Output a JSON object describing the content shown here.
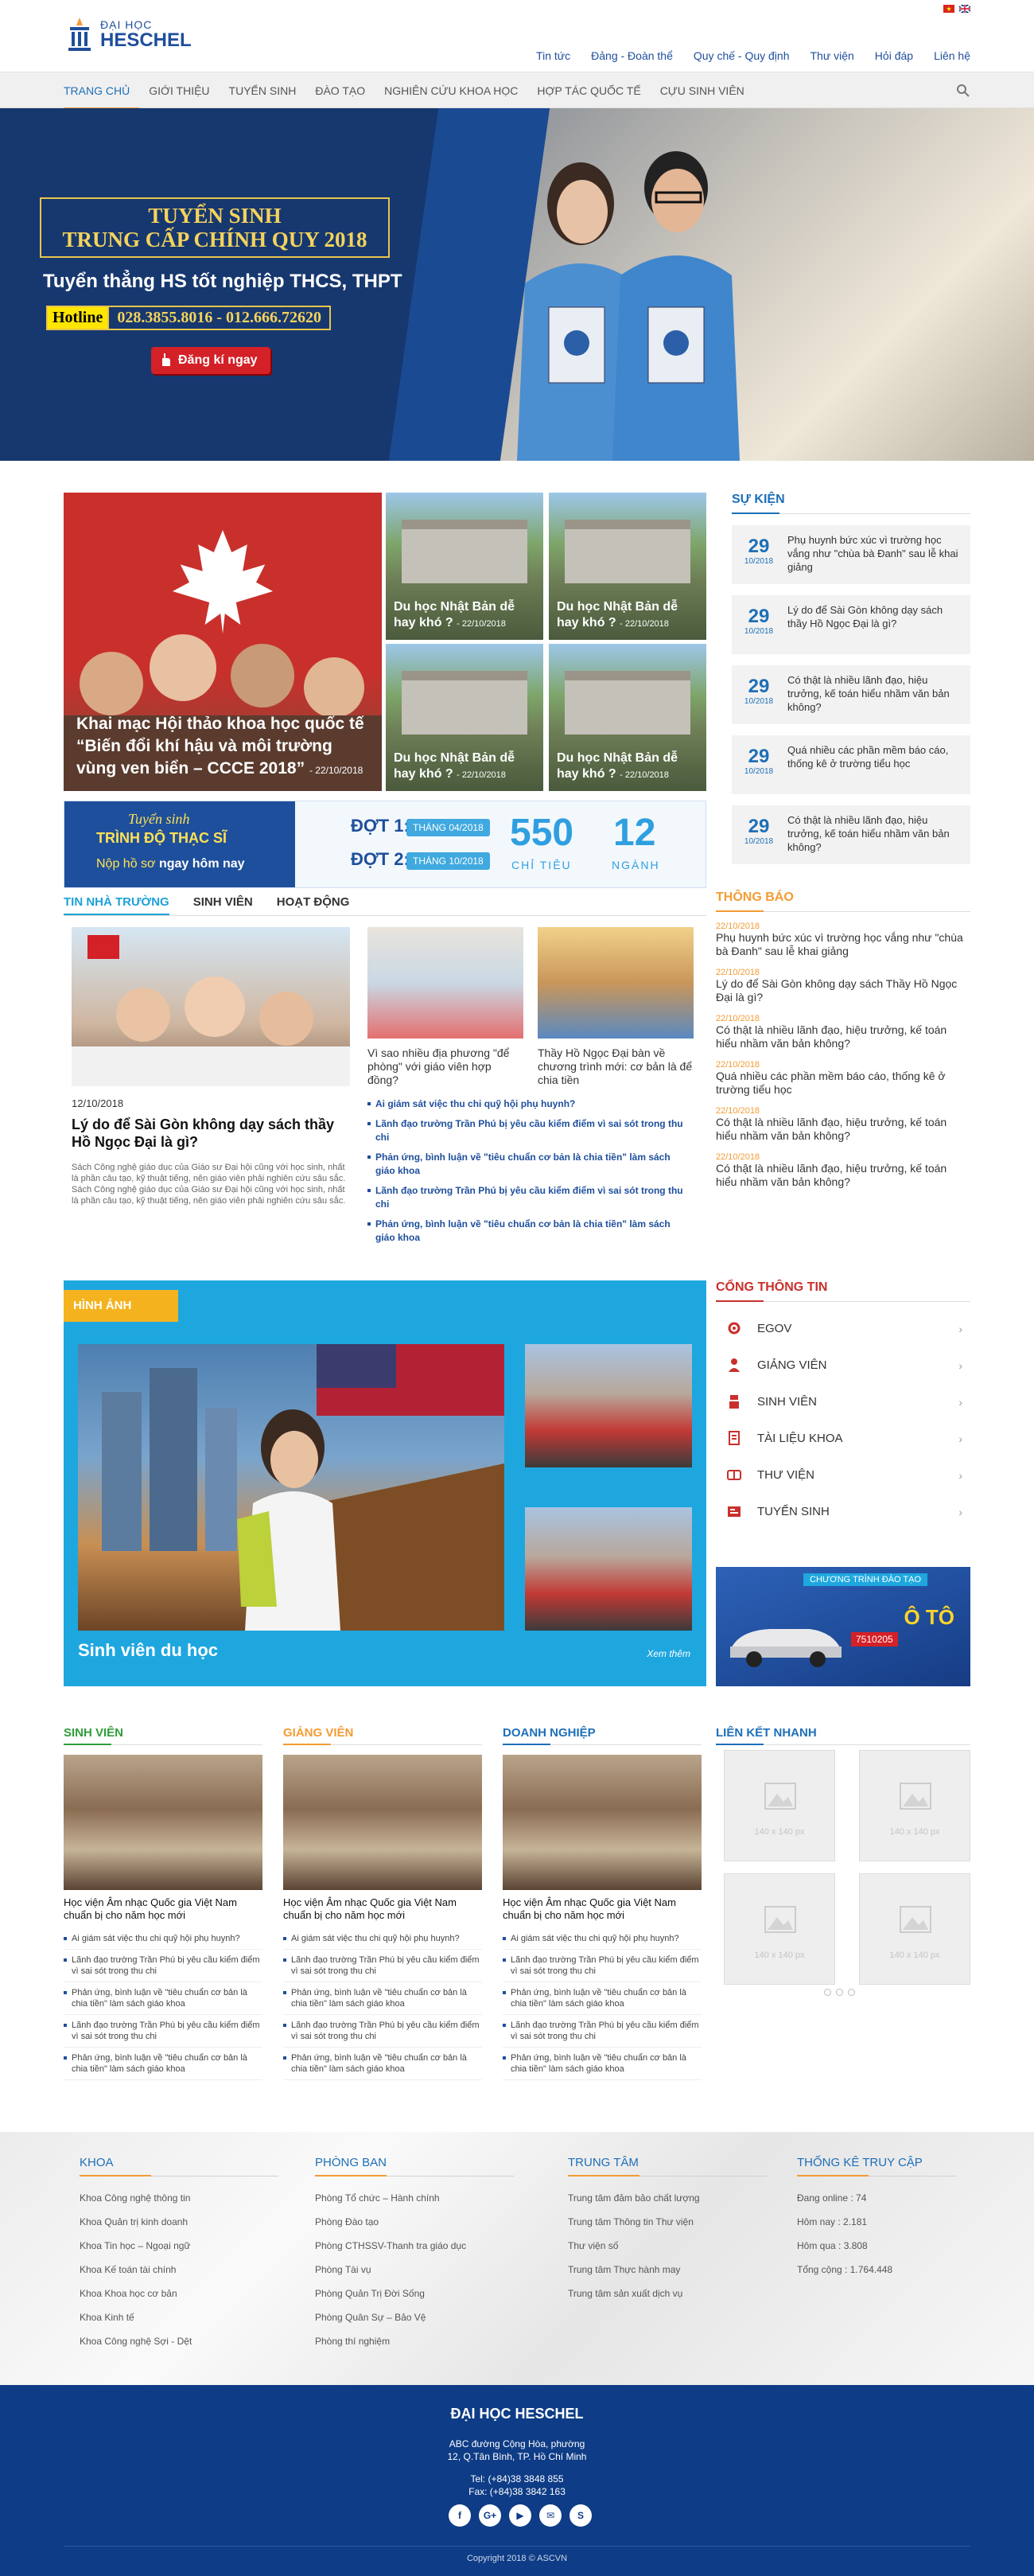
{
  "header": {
    "logo_line1": "ĐẠI HỌC",
    "logo_line2": "HESCHEL",
    "top_links": [
      "Tin tức",
      "Đảng - Đoàn thể",
      "Quy chế - Quy định",
      "Thư viện",
      "Hỏi đáp",
      "Liên hệ"
    ],
    "main_nav": [
      "TRANG CHỦ",
      "GIỚI THIỆU",
      "TUYỂN SINH",
      "ĐÀO TẠO",
      "NGHIÊN CỨU KHOA HỌC",
      "HỢP TÁC QUỐC TẾ",
      "CỰU SINH VIÊN"
    ]
  },
  "hero": {
    "title1": "TUYỂN SINH",
    "title2": "TRUNG CẤP CHÍNH QUY 2018",
    "subtitle": "Tuyển thẳng HS tốt nghiệp THCS, THPT",
    "hotline_label": "Hotline",
    "hotline_number": "028.3855.8016 - 012.666.72620",
    "button": "Đăng kí ngay"
  },
  "featured": {
    "big": {
      "title": "Khai mạc Hội thảo khoa học quốc tế “Biến đổi khí hậu và môi trường vùng ven biển – CCCE 2018”",
      "date": "- 22/10/2018"
    },
    "small": [
      {
        "title": "Du học Nhật Bản dễ hay khó ?",
        "date": "- 22/10/2018"
      },
      {
        "title": "Du học Nhật Bản dễ hay khó ?",
        "date": "- 22/10/2018"
      },
      {
        "title": "Du học Nhật Bản dễ hay khó ?",
        "date": "- 22/10/2018"
      },
      {
        "title": "Du học Nhật Bản dễ hay khó ?",
        "date": "- 22/10/2018"
      }
    ]
  },
  "banner": {
    "line1": "Tuyển sinh",
    "line2": "TRÌNH ĐỘ THẠC SĨ",
    "line3a": "Nộp hồ sơ",
    "line3b": " ngay hôm nay",
    "dot1": "ĐỢT 1:",
    "dot1_date": "THÁNG 04/2018",
    "dot2": "ĐỢT 2:",
    "dot2_date": "THÁNG 10/2018",
    "quota": "550",
    "quota_label": "CHỈ TIÊU",
    "majors": "12",
    "majors_label": "NGÀNH"
  },
  "events": {
    "heading": "SỰ KIỆN",
    "items": [
      {
        "day": "29",
        "month": "10/2018",
        "title": "Phụ huynh bức xúc vì trường học vắng như \"chùa bà Đanh\" sau lễ khai giảng"
      },
      {
        "day": "29",
        "month": "10/2018",
        "title": "Lý do để Sài Gòn không dạy sách thầy Hồ Ngọc Đại là gì?"
      },
      {
        "day": "29",
        "month": "10/2018",
        "title": "Có thật là nhiều lãnh đạo, hiệu trưởng, kế toán hiểu nhầm văn bản không?"
      },
      {
        "day": "29",
        "month": "10/2018",
        "title": "Quá nhiều các phần mềm báo cáo, thống kê ở trường tiểu học"
      },
      {
        "day": "29",
        "month": "10/2018",
        "title": "Có thật là nhiều lãnh đạo, hiệu trưởng, kế toán hiểu nhầm văn bản không?"
      }
    ]
  },
  "news": {
    "tabs": [
      "TIN NHÀ TRƯỜNG",
      "SINH VIÊN",
      "HOẠT ĐỘNG"
    ],
    "main": {
      "date": "12/10/2018",
      "title": "Lý do để Sài Gòn không dạy sách thầy Hồ Ngọc Đại là gì?",
      "desc": "Sách Công nghệ giáo dục của Giáo sư Đại hội cũng với học sinh, nhất là phần câu tạo, kỹ thuật tiếng, nên giáo viên phải nghiên cứu sâu sắc. Sách Công nghệ giáo dục của Giáo sư Đại hội cũng với học sinh, nhất là phần câu tạo, kỹ thuật tiếng, nên giáo viên phải nghiên cứu sâu sắc."
    },
    "side": [
      {
        "title": "Vì sao nhiều địa phương \"để phòng\" với giáo viên hợp đồng?"
      },
      {
        "title": "Thầy Hồ Ngọc Đại bàn về chương trình mới: cơ bản là để chia tiền"
      }
    ],
    "list": [
      "Ai giám sát việc thu chi quỹ hội phụ huynh?",
      "Lãnh đạo trường Trần Phú bị yêu cầu kiểm điểm vì sai sót trong thu chi",
      "Phản ứng, bình luận về \"tiêu chuẩn cơ bản là chia tiền\" làm sách giáo khoa",
      "Lãnh đạo trường Trần Phú bị yêu cầu kiểm điểm vì sai sót trong thu chi",
      "Phản ứng, bình luận về \"tiêu chuẩn cơ bản là chia tiền\" làm sách giáo khoa"
    ]
  },
  "notices": {
    "heading": "THÔNG BÁO",
    "items": [
      {
        "date": "22/10/2018",
        "title": "Phụ huynh bức xúc vì trường học vắng như \"chùa bà Đanh\" sau lễ khai giảng"
      },
      {
        "date": "22/10/2018",
        "title": "Lý do để Sài Gòn không dạy sách Thầy Hồ Ngọc Đại là gì?"
      },
      {
        "date": "22/10/2018",
        "title": "Có thật là nhiều lãnh đạo, hiệu trưởng, kế toán hiểu nhầm văn bản không?"
      },
      {
        "date": "22/10/2018",
        "title": "Quá nhiều các phần mềm báo cáo, thống kê ở trường tiểu học"
      },
      {
        "date": "22/10/2018",
        "title": "Có thật là nhiều lãnh đạo, hiệu trưởng, kế toán hiểu nhầm văn bản không?"
      },
      {
        "date": "22/10/2018",
        "title": "Có thật là nhiều lãnh đạo, hiệu trưởng, kế toán hiểu nhầm văn bản không?"
      }
    ]
  },
  "gallery": {
    "heading": "HÌNH ẢNH",
    "caption": "Sinh viên du học",
    "more": "Xem thêm"
  },
  "portal": {
    "heading": "CỔNG THÔNG TIN",
    "items": [
      {
        "label": "EGOV",
        "icon": "gear-icon"
      },
      {
        "label": "GIẢNG VIÊN",
        "icon": "teacher-icon"
      },
      {
        "label": "SINH VIÊN",
        "icon": "student-icon"
      },
      {
        "label": "TÀI LIỆU KHOA",
        "icon": "document-icon"
      },
      {
        "label": "THƯ VIỆN",
        "icon": "library-icon"
      },
      {
        "label": "TUYỂN SINH",
        "icon": "enrollment-icon"
      }
    ]
  },
  "ad": {
    "top": "CHƯƠNG TRÌNH ĐÀO TẠO",
    "big": "Ô TÔ",
    "code": "7510205"
  },
  "columns": [
    {
      "heading": "SINH VIÊN",
      "color": "#2e9e3a",
      "title": "Học viện Âm nhạc Quốc gia Việt Nam chuẩn bị cho năm học mới",
      "list": [
        "Ai giám sát việc thu chi quỹ hội phụ huynh?",
        "Lãnh đạo trường Trần Phú bị yêu cầu kiểm điểm vì sai sót trong thu chi",
        "Phản ứng, bình luận về \"tiêu chuẩn cơ bản là chia tiền\" làm sách giáo khoa",
        "Lãnh đạo trường Trần Phú bị yêu cầu kiểm điểm vì sai sót trong thu chi",
        "Phản ứng, bình luận về \"tiêu chuẩn cơ bản là chia tiền\" làm sách giáo khoa"
      ]
    },
    {
      "heading": "GIẢNG VIÊN",
      "color": "#f39c34",
      "title": "Học viện Âm nhạc Quốc gia Việt Nam chuẩn bị cho năm học mới",
      "list": [
        "Ai giám sát việc thu chi quỹ hội phụ huynh?",
        "Lãnh đạo trường Trần Phú bị yêu cầu kiểm điểm vì sai sót trong thu chi",
        "Phản ứng, bình luận về \"tiêu chuẩn cơ bản là chia tiền\" làm sách giáo khoa",
        "Lãnh đạo trường Trần Phú bị yêu cầu kiểm điểm vì sai sót trong thu chi",
        "Phản ứng, bình luận về \"tiêu chuẩn cơ bản là chia tiền\" làm sách giáo khoa"
      ]
    },
    {
      "heading": "DOANH NGHIỆP",
      "color": "#1e6fb8",
      "title": "Học viện Âm nhạc Quốc gia Việt Nam chuẩn bị cho năm học mới",
      "list": [
        "Ai giám sát việc thu chi quỹ hội phụ huynh?",
        "Lãnh đạo trường Trần Phú bị yêu cầu kiểm điểm vì sai sót trong thu chi",
        "Phản ứng, bình luận về \"tiêu chuẩn cơ bản là chia tiền\" làm sách giáo khoa",
        "Lãnh đạo trường Trần Phú bị yêu cầu kiểm điểm vì sai sót trong thu chi",
        "Phản ứng, bình luận về \"tiêu chuẩn cơ bản là chia tiền\" làm sách giáo khoa"
      ]
    }
  ],
  "quick_links": {
    "heading": "LIÊN KẾT NHANH",
    "placeholder": "140 x 140 px"
  },
  "footer": {
    "cols": [
      {
        "heading": "KHOA",
        "items": [
          "Khoa Công nghệ thông tin",
          "Khoa Quản trị kinh doanh",
          "Khoa Tin học – Ngoại ngữ",
          "Khoa Kế toán tài chính",
          "Khoa Khoa học cơ bản",
          "Khoa Kinh tế",
          "Khoa Công nghệ Sợi - Dệt"
        ]
      },
      {
        "heading": "PHÒNG BAN",
        "items": [
          "Phòng Tổ chức – Hành chính",
          "Phòng Đào tạo",
          "Phòng CTHSSV-Thanh tra giáo dục",
          "Phòng Tài vụ",
          "Phòng Quản Trị Đời Sống",
          "Phòng Quân Sự – Bảo Vệ",
          "Phòng thí nghiệm"
        ]
      },
      {
        "heading": "TRUNG TÂM",
        "items": [
          "Trung tâm đảm bảo chất lượng",
          "Trung tâm Thông tin Thư viện",
          "Thư viện số",
          "Trung tâm Thực hành may",
          "Trung tâm sản xuất dịch vụ"
        ]
      },
      {
        "heading": "THỐNG KÊ TRUY CẬP",
        "items": [
          "Đang online : 74",
          "Hôm nay : 2.181",
          "Hôm qua : 3.808",
          "Tổng cộng : 1.764.448"
        ]
      }
    ],
    "name": "ĐẠI HỌC HESCHEL",
    "addr1": "ABC đường Cộng Hòa, phường",
    "addr2": "12, Q.Tân Bình, TP. Hồ Chí Minh",
    "tel": "Tel: (+84)38 3848 855",
    "fax": "Fax: (+84)38 3842 163",
    "social": [
      "f",
      "G+",
      "▶",
      "✉",
      "S"
    ],
    "copyright": "Copyright  2018 © ASCVN"
  }
}
